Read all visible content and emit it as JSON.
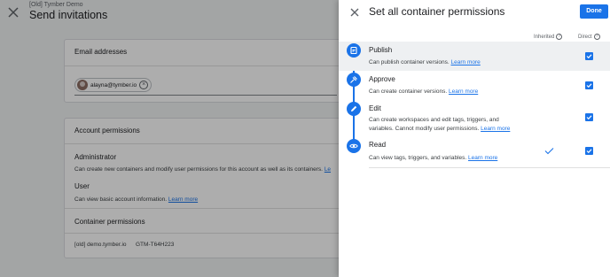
{
  "background": {
    "subtitle": "[Old] Tymber Demo",
    "title": "Send invitations",
    "email_card": {
      "heading": "Email addresses",
      "chip_email": "alayna@tymber.io"
    },
    "permissions_card": {
      "heading": "Account permissions",
      "administrator_label": "Administrator",
      "administrator_desc": "Can create new containers and modify user permissions for this account as well as its containers.",
      "administrator_link": "Le",
      "user_label": "User",
      "user_desc": "Can view basic account information.",
      "user_link": "Learn more",
      "container_heading": "Container permissions",
      "container_name": "[old] demo.tymber.io",
      "container_id": "GTM-T64H223"
    }
  },
  "panel": {
    "title": "Set all container permissions",
    "done_label": "Done",
    "col_inherited": "Inherited",
    "col_direct": "Direct",
    "rows": [
      {
        "title": "Publish",
        "desc": "Can publish container versions.",
        "link": "Learn more",
        "direct": true,
        "inherited": false,
        "icon": "publish-icon"
      },
      {
        "title": "Approve",
        "desc": "Can create container versions.",
        "link": "Learn more",
        "direct": true,
        "inherited": false,
        "icon": "approve-icon"
      },
      {
        "title": "Edit",
        "desc_line1": "Can create workspaces and edit tags, triggers, and",
        "desc_line2": "variables. Cannot modify user permissions.",
        "link": "Learn more",
        "direct": true,
        "inherited": false,
        "icon": "edit-icon"
      },
      {
        "title": "Read",
        "desc": "Can view tags, triggers, and variables.",
        "link": "Learn more",
        "direct": true,
        "inherited": true,
        "icon": "eye-icon"
      }
    ]
  },
  "colors": {
    "accent": "#1a73e8",
    "scrim": "rgba(0,0,0,0.32)"
  }
}
